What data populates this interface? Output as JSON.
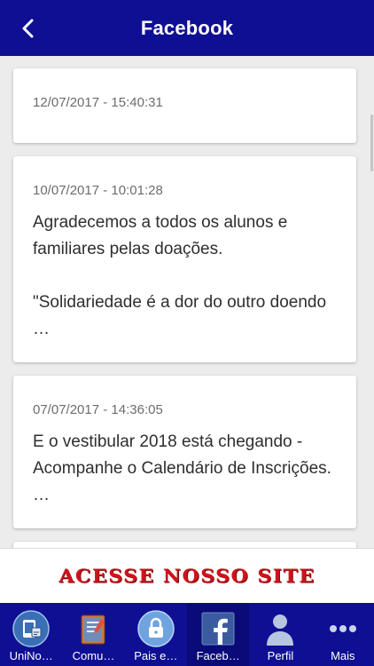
{
  "header": {
    "title": "Facebook",
    "back_icon": "chevron-left-icon"
  },
  "posts": [
    {
      "date": "12/07/2017 - 15:40:31",
      "text": ""
    },
    {
      "date": "10/07/2017 - 10:01:28",
      "text": "Agradecemos a todos os alunos e familiares pelas doações.\n\n\"Solidariedade é a dor do outro doendo …"
    },
    {
      "date": "07/07/2017 - 14:36:05",
      "text": "E o vestibular 2018 está chegando - Acompanhe o Calendário de Inscrições. …"
    }
  ],
  "banner": {
    "text": "ACESSE NOSSO SITE",
    "color": "#d1121a"
  },
  "tabbar": {
    "tabs": [
      {
        "label": "UniNo…",
        "icon": "uninorte-app-icon"
      },
      {
        "label": "Comu…",
        "icon": "comunicados-book-icon"
      },
      {
        "label": "Pais e…",
        "icon": "lock-icon"
      },
      {
        "label": "Faceb…",
        "icon": "facebook-icon",
        "active": true
      },
      {
        "label": "Perfil",
        "icon": "person-icon"
      },
      {
        "label": "Mais",
        "icon": "more-dots-icon"
      }
    ]
  },
  "colors": {
    "primary": "#0f0f94",
    "background": "#ececec",
    "card": "#ffffff"
  }
}
